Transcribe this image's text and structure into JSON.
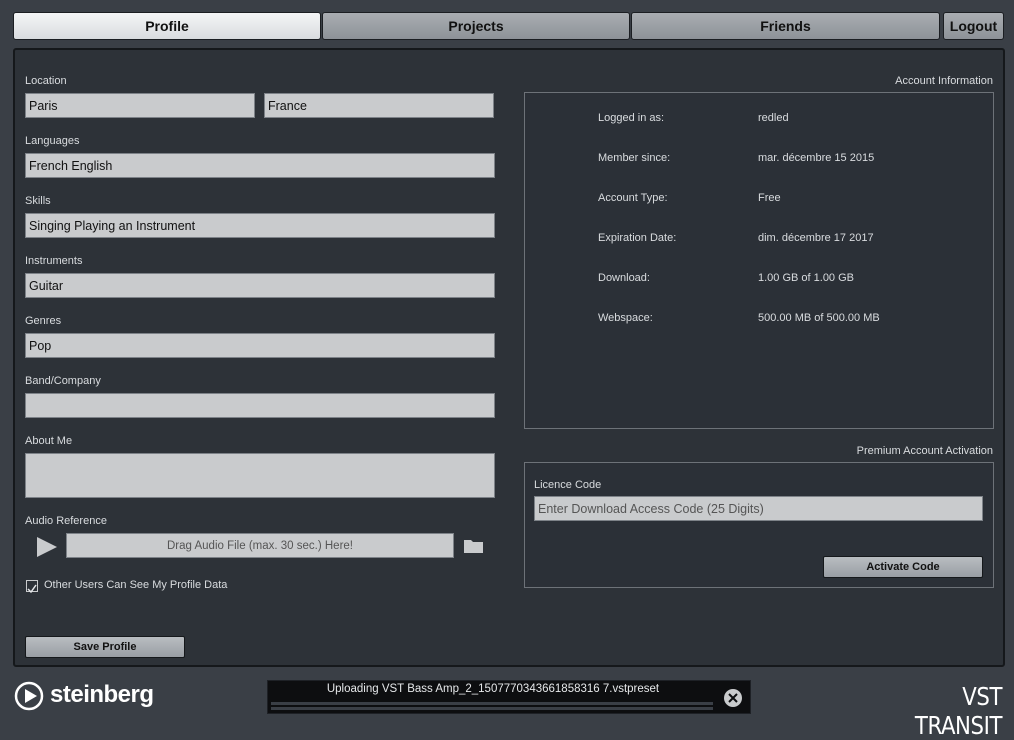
{
  "tabs": {
    "profile": "Profile",
    "projects": "Projects",
    "friends": "Friends",
    "logout": "Logout"
  },
  "profile": {
    "location_label": "Location",
    "city": "Paris",
    "country": "France",
    "languages_label": "Languages",
    "languages": "French English",
    "skills_label": "Skills",
    "skills": "Singing Playing an Instrument",
    "instruments_label": "Instruments",
    "instruments": "Guitar",
    "genres_label": "Genres",
    "genres": "Pop",
    "band_label": "Band/Company",
    "band": "",
    "about_label": "About Me",
    "about": "",
    "audio_label": "Audio Reference",
    "audio_drop": "Drag Audio File (max. 30 sec.) Here!",
    "visibility_label": "Other Users Can See My Profile Data",
    "visibility_checked": true,
    "save_button": "Save Profile"
  },
  "account": {
    "title": "Account Information",
    "rows": [
      {
        "key": "Logged in as:",
        "value": "redled"
      },
      {
        "key": "Member since:",
        "value": "mar. décembre 15 2015"
      },
      {
        "key": "Account Type:",
        "value": "Free"
      },
      {
        "key": "Expiration Date:",
        "value": "dim. décembre 17 2017"
      },
      {
        "key": "Download:",
        "value": "1.00 GB of 1.00 GB"
      },
      {
        "key": "Webspace:",
        "value": "500.00 MB of 500.00 MB"
      }
    ]
  },
  "premium": {
    "title": "Premium Account Activation",
    "licence_label": "Licence Code",
    "licence_placeholder": "Enter Download Access Code (25 Digits)",
    "activate_button": "Activate Code"
  },
  "footer": {
    "brand": "steinberg",
    "upload_text": "Uploading  VST Bass Amp_2_1507770343661858316 7.vstpreset",
    "product": "VST TRANSIT"
  },
  "icons": {
    "play": "play-icon",
    "folder": "folder-icon",
    "close": "close-icon",
    "checkbox": "checkmark-icon",
    "logo": "steinberg-logo-icon"
  },
  "colors": {
    "background": "#3a3f46",
    "panel": "#2d3238",
    "field": "#c9cbcd",
    "tab_active": "#eceef0"
  }
}
